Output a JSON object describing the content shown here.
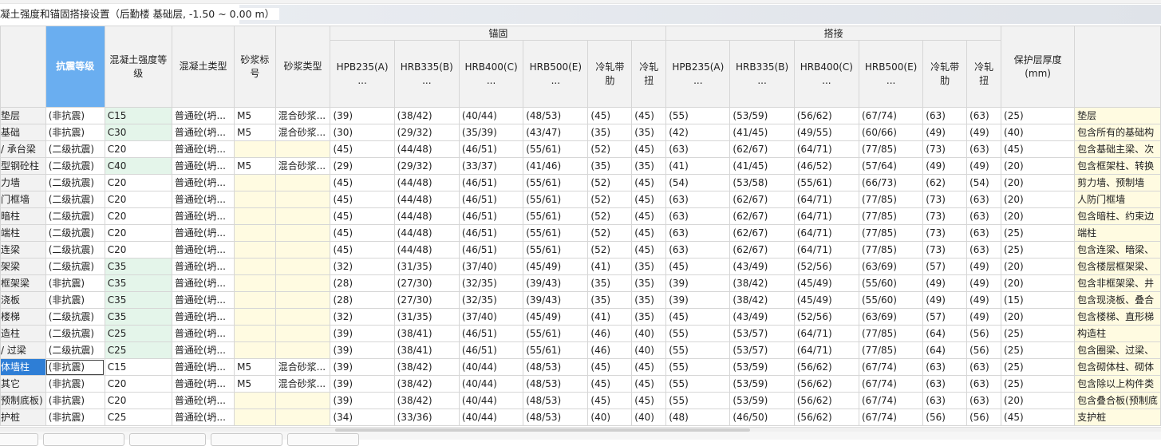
{
  "title": "凝土强度和锚固搭接设置（后勤楼  基础层, -1.50 ~ 0.00 m）",
  "header": {
    "group_anchor": "锚固",
    "group_lap": "搭接",
    "seismic": "抗震等级",
    "concrete_grade": "混凝土强度等级",
    "concrete_type": "混凝土类型",
    "mortar_grade": "砂浆标号",
    "mortar_type": "砂浆类型",
    "anchor_cols": [
      "HPB235(A)\n...",
      "HRB335(B)\n...",
      "HRB400(C)\n...",
      "HRB500(E)\n...",
      "冷轧带肋",
      "冷轧扭"
    ],
    "lap_cols": [
      "HPB235(A)\n...",
      "HRB335(B)\n...",
      "HRB400(C)\n...",
      "HRB500(E)\n...",
      "冷轧带肋",
      "冷轧扭"
    ],
    "cover": "保护层厚度(mm)"
  },
  "rows": [
    {
      "name": "垫层",
      "seismic": "(非抗震)",
      "grade": "C15",
      "type": "普通砼(坍...",
      "mortar": "M5",
      "mortar_type": "混合砂浆...",
      "anchor": [
        "(39)",
        "(38/42)",
        "(40/44)",
        "(48/53)",
        "(45)",
        "(45)"
      ],
      "lap": [
        "(55)",
        "(53/59)",
        "(56/62)",
        "(67/74)",
        "(63)",
        "(63)"
      ],
      "cover": "(25)",
      "note": "垫层"
    },
    {
      "name": "基础",
      "seismic": "(非抗震)",
      "grade": "C30",
      "type": "普通砼(坍...",
      "mortar": "M5",
      "mortar_type": "混合砂浆...",
      "anchor": [
        "(30)",
        "(29/32)",
        "(35/39)",
        "(43/47)",
        "(35)",
        "(35)"
      ],
      "lap": [
        "(42)",
        "(41/45)",
        "(49/55)",
        "(60/66)",
        "(49)",
        "(49)"
      ],
      "cover": "(40)",
      "note": "包含所有的基础构"
    },
    {
      "name": " / 承台梁",
      "seismic": "(二级抗震)",
      "grade": "C20",
      "type": "普通砼(坍...",
      "mortar": "",
      "mortar_type": "",
      "anchor": [
        "(45)",
        "(44/48)",
        "(46/51)",
        "(55/61)",
        "(52)",
        "(45)"
      ],
      "lap": [
        "(63)",
        "(62/67)",
        "(64/71)",
        "(77/85)",
        "(73)",
        "(63)"
      ],
      "cover": "(45)",
      "note": "包含基础主梁、次"
    },
    {
      "name": "型钢砼柱",
      "seismic": "(二级抗震)",
      "grade": "C40",
      "type": "普通砼(坍...",
      "mortar": "M5",
      "mortar_type": "混合砂浆...",
      "anchor": [
        "(29)",
        "(29/32)",
        "(33/37)",
        "(41/46)",
        "(35)",
        "(35)"
      ],
      "lap": [
        "(41)",
        "(41/45)",
        "(46/52)",
        "(57/64)",
        "(49)",
        "(49)"
      ],
      "cover": "(20)",
      "note": "包含框架柱、转换"
    },
    {
      "name": "力墙",
      "seismic": "(二级抗震)",
      "grade": "C20",
      "type": "普通砼(坍...",
      "mortar": "",
      "mortar_type": "",
      "anchor": [
        "(45)",
        "(44/48)",
        "(46/51)",
        "(55/61)",
        "(52)",
        "(45)"
      ],
      "lap": [
        "(54)",
        "(53/58)",
        "(55/61)",
        "(66/73)",
        "(62)",
        "(54)"
      ],
      "cover": "(20)",
      "note": "剪力墙、预制墙"
    },
    {
      "name": "门框墙",
      "seismic": "(二级抗震)",
      "grade": "C20",
      "type": "普通砼(坍...",
      "mortar": "",
      "mortar_type": "",
      "anchor": [
        "(45)",
        "(44/48)",
        "(46/51)",
        "(55/61)",
        "(52)",
        "(45)"
      ],
      "lap": [
        "(63)",
        "(62/67)",
        "(64/71)",
        "(77/85)",
        "(73)",
        "(63)"
      ],
      "cover": "(20)",
      "note": "人防门框墙"
    },
    {
      "name": "暗柱",
      "seismic": "(二级抗震)",
      "grade": "C20",
      "type": "普通砼(坍...",
      "mortar": "",
      "mortar_type": "",
      "anchor": [
        "(45)",
        "(44/48)",
        "(46/51)",
        "(55/61)",
        "(52)",
        "(45)"
      ],
      "lap": [
        "(63)",
        "(62/67)",
        "(64/71)",
        "(77/85)",
        "(73)",
        "(63)"
      ],
      "cover": "(20)",
      "note": "包含暗柱、约束边"
    },
    {
      "name": "端柱",
      "seismic": "(二级抗震)",
      "grade": "C20",
      "type": "普通砼(坍...",
      "mortar": "",
      "mortar_type": "",
      "anchor": [
        "(45)",
        "(44/48)",
        "(46/51)",
        "(55/61)",
        "(52)",
        "(45)"
      ],
      "lap": [
        "(63)",
        "(62/67)",
        "(64/71)",
        "(77/85)",
        "(73)",
        "(63)"
      ],
      "cover": "(25)",
      "note": "端柱"
    },
    {
      "name": "连梁",
      "seismic": "(二级抗震)",
      "grade": "C20",
      "type": "普通砼(坍...",
      "mortar": "",
      "mortar_type": "",
      "anchor": [
        "(45)",
        "(44/48)",
        "(46/51)",
        "(55/61)",
        "(52)",
        "(45)"
      ],
      "lap": [
        "(63)",
        "(62/67)",
        "(64/71)",
        "(77/85)",
        "(73)",
        "(63)"
      ],
      "cover": "(25)",
      "note": "包含连梁、暗梁、"
    },
    {
      "name": "架梁",
      "seismic": "(二级抗震)",
      "grade": "C35",
      "type": "普通砼(坍...",
      "mortar": "",
      "mortar_type": "",
      "anchor": [
        "(32)",
        "(31/35)",
        "(37/40)",
        "(45/49)",
        "(41)",
        "(35)"
      ],
      "lap": [
        "(45)",
        "(43/49)",
        "(52/56)",
        "(63/69)",
        "(57)",
        "(49)"
      ],
      "cover": "(20)",
      "note": "包含楼层框架梁、"
    },
    {
      "name": "框架梁",
      "seismic": "(非抗震)",
      "grade": "C35",
      "type": "普通砼(坍...",
      "mortar": "",
      "mortar_type": "",
      "anchor": [
        "(28)",
        "(27/30)",
        "(32/35)",
        "(39/43)",
        "(35)",
        "(35)"
      ],
      "lap": [
        "(39)",
        "(38/42)",
        "(45/49)",
        "(55/60)",
        "(49)",
        "(49)"
      ],
      "cover": "(20)",
      "note": "包含非框架梁、井"
    },
    {
      "name": "浇板",
      "seismic": "(非抗震)",
      "grade": "C35",
      "type": "普通砼(坍...",
      "mortar": "",
      "mortar_type": "",
      "anchor": [
        "(28)",
        "(27/30)",
        "(32/35)",
        "(39/43)",
        "(35)",
        "(35)"
      ],
      "lap": [
        "(39)",
        "(38/42)",
        "(45/49)",
        "(55/60)",
        "(49)",
        "(49)"
      ],
      "cover": "(15)",
      "note": "包含现浇板、叠合"
    },
    {
      "name": "楼梯",
      "seismic": "(二级抗震)",
      "grade": "C35",
      "type": "普通砼(坍...",
      "mortar": "",
      "mortar_type": "",
      "anchor": [
        "(32)",
        "(31/35)",
        "(37/40)",
        "(45/49)",
        "(41)",
        "(35)"
      ],
      "lap": [
        "(45)",
        "(43/49)",
        "(52/56)",
        "(63/69)",
        "(57)",
        "(49)"
      ],
      "cover": "(20)",
      "note": "包含楼梯、直形梯"
    },
    {
      "name": "造柱",
      "seismic": "(二级抗震)",
      "grade": "C25",
      "type": "普通砼(坍...",
      "mortar": "",
      "mortar_type": "",
      "anchor": [
        "(39)",
        "(38/41)",
        "(46/51)",
        "(55/61)",
        "(46)",
        "(40)"
      ],
      "lap": [
        "(55)",
        "(53/57)",
        "(64/71)",
        "(77/85)",
        "(64)",
        "(56)"
      ],
      "cover": "(25)",
      "note": "构造柱"
    },
    {
      "name": " / 过梁",
      "seismic": "(二级抗震)",
      "grade": "C25",
      "type": "普通砼(坍...",
      "mortar": "",
      "mortar_type": "",
      "anchor": [
        "(39)",
        "(38/41)",
        "(46/51)",
        "(55/61)",
        "(46)",
        "(40)"
      ],
      "lap": [
        "(55)",
        "(53/57)",
        "(64/71)",
        "(77/85)",
        "(64)",
        "(56)"
      ],
      "cover": "(25)",
      "note": "包含圈梁、过梁、"
    },
    {
      "name": "体墙柱",
      "seismic": "(非抗震)",
      "grade": "C15",
      "type": "普通砼(坍...",
      "mortar": "M5",
      "mortar_type": "混合砂浆...",
      "anchor": [
        "(39)",
        "(38/42)",
        "(40/44)",
        "(48/53)",
        "(45)",
        "(45)"
      ],
      "lap": [
        "(55)",
        "(53/59)",
        "(56/62)",
        "(67/74)",
        "(63)",
        "(63)"
      ],
      "cover": "(25)",
      "note": "包含砌体柱、砌体"
    },
    {
      "name": "其它",
      "seismic": "(非抗震)",
      "grade": "C20",
      "type": "普通砼(坍...",
      "mortar": "M5",
      "mortar_type": "混合砂浆...",
      "anchor": [
        "(39)",
        "(38/42)",
        "(40/44)",
        "(48/53)",
        "(45)",
        "(45)"
      ],
      "lap": [
        "(55)",
        "(53/59)",
        "(56/62)",
        "(67/74)",
        "(63)",
        "(63)"
      ],
      "cover": "(25)",
      "note": "包含除以上构件类"
    },
    {
      "name": "预制底板)",
      "seismic": "(非抗震)",
      "grade": "C20",
      "type": "普通砼(坍...",
      "mortar": "",
      "mortar_type": "",
      "anchor": [
        "(39)",
        "(38/42)",
        "(40/44)",
        "(48/53)",
        "(45)",
        "(45)"
      ],
      "lap": [
        "(55)",
        "(53/59)",
        "(56/62)",
        "(67/74)",
        "(63)",
        "(63)"
      ],
      "cover": "(20)",
      "note": "包含叠合板(预制底"
    },
    {
      "name": "护桩",
      "seismic": "(非抗震)",
      "grade": "C25",
      "type": "普通砼(坍...",
      "mortar": "",
      "mortar_type": "",
      "anchor": [
        "(34)",
        "(33/36)",
        "(40/44)",
        "(48/53)",
        "(40)",
        "(40)"
      ],
      "lap": [
        "(48)",
        "(46/50)",
        "(56/62)",
        "(67/74)",
        "(56)",
        "(56)"
      ],
      "cover": "(45)",
      "note": "支护桩"
    }
  ],
  "selected_row": 15,
  "green_grade_rows": [
    0,
    1,
    3,
    9,
    10,
    11,
    12,
    13,
    14
  ],
  "colors": {
    "seismic_header": "#6aaef0",
    "selected_name": "#2e7ed6",
    "green_cell": "#e4f5ea",
    "yellow_cell": "#fffbe1"
  }
}
